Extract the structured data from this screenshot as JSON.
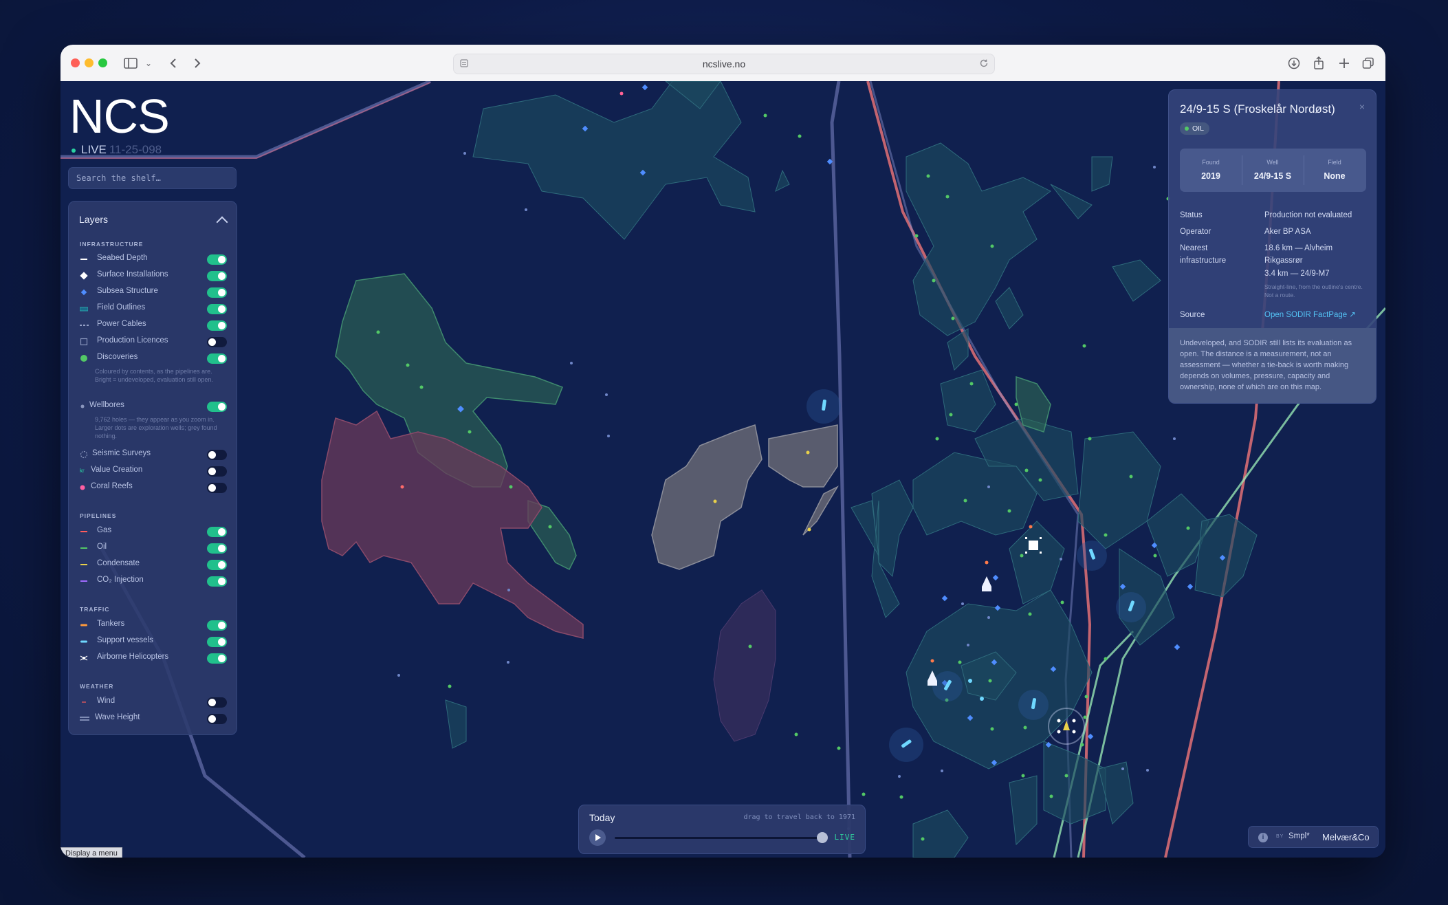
{
  "browser": {
    "url": "ncslive.no"
  },
  "brand": {
    "title": "NCS",
    "live_label": "LIVE",
    "live_code": "11-25-098"
  },
  "search": {
    "placeholder": "Search the shelf…"
  },
  "layers": {
    "title": "Layers",
    "sections": {
      "infrastructure": "INFRASTRUCTURE",
      "pipelines": "PIPELINES",
      "traffic": "TRAFFIC",
      "weather": "WEATHER"
    },
    "items": [
      {
        "label": "Seabed Depth",
        "on": true,
        "color": "#ffffff"
      },
      {
        "label": "Surface Installations",
        "on": true,
        "color": "#ffffff"
      },
      {
        "label": "Subsea Structure",
        "on": true,
        "color": "#4f8dff"
      },
      {
        "label": "Field Outlines",
        "on": true,
        "color": "#1a8a8a"
      },
      {
        "label": "Power Cables",
        "on": true,
        "color": "#b8c3e6"
      },
      {
        "label": "Production Licences",
        "on": false,
        "color": "#8a96bd"
      },
      {
        "label": "Discoveries",
        "on": true,
        "color": "#53c866"
      },
      {
        "label": "Wellbores",
        "on": true,
        "color": "#8a96bd"
      },
      {
        "label": "Seismic Surveys",
        "on": false,
        "color": "#8a96bd"
      },
      {
        "label": "Value Creation",
        "on": false,
        "color": "#2ad1a1"
      },
      {
        "label": "Coral Reefs",
        "on": false,
        "color": "#ff5fa2"
      },
      {
        "label": "Gas",
        "on": true,
        "color": "#ff5c5c"
      },
      {
        "label": "Oil",
        "on": true,
        "color": "#53c866"
      },
      {
        "label": "Condensate",
        "on": true,
        "color": "#e8d04a"
      },
      {
        "label": "CO₂ Injection",
        "on": true,
        "color": "#a06bff"
      },
      {
        "label": "Tankers",
        "on": true,
        "color": "#ff9a3c"
      },
      {
        "label": "Support vessels",
        "on": true,
        "color": "#6fd8ff"
      },
      {
        "label": "Airborne Helicopters",
        "on": true,
        "color": "#ffffff"
      },
      {
        "label": "Wind",
        "on": false,
        "color": "#ff5c5c"
      },
      {
        "label": "Wave Height",
        "on": false,
        "color": "#b8c3e6"
      }
    ],
    "discoveries_note": "Coloured by contents, as the pipelines are. Bright = undeveloped, evaluation still open.",
    "wellbores_note": "9,762 holes — they appear as you zoom in. Larger dots are exploration wells; grey found nothing."
  },
  "detail": {
    "title": "24/9-15 S (Froskelår Nordøst)",
    "badge": "OIL",
    "close": "×",
    "stats": [
      {
        "key": "Found",
        "value": "2019"
      },
      {
        "key": "Well",
        "value": "24/9-15 S"
      },
      {
        "key": "Field",
        "value": "None"
      }
    ],
    "status_label": "Status",
    "status_value": "Production not evaluated",
    "operator_label": "Operator",
    "operator_value": "Aker BP ASA",
    "nearest_label_1": "Nearest",
    "nearest_label_2": "infrastructure",
    "nearest_1": "18.6 km — Alvheim",
    "nearest_1b": "Rikgassrør",
    "nearest_2": "3.4 km — 24/9-M7",
    "nearest_note": "Straight-line, from the outline's centre. Not a route.",
    "source_label": "Source",
    "source_link": "Open SODIR FactPage ↗",
    "footnote": "Undeveloped, and SODIR still lists its evaluation as open. The distance is a measurement, not an assessment — whether a tie-back is worth making depends on volumes, pressure, capacity and ownership, none of which are on this map."
  },
  "timeline": {
    "label": "Today",
    "hint": "drag to travel back to 1971",
    "live": "LIVE",
    "position": 1.0
  },
  "credit": {
    "info": "i",
    "by": "BY",
    "studio": "Smpl*",
    "partner": "Melvær&Co"
  },
  "tooltip": "Display a menu"
}
